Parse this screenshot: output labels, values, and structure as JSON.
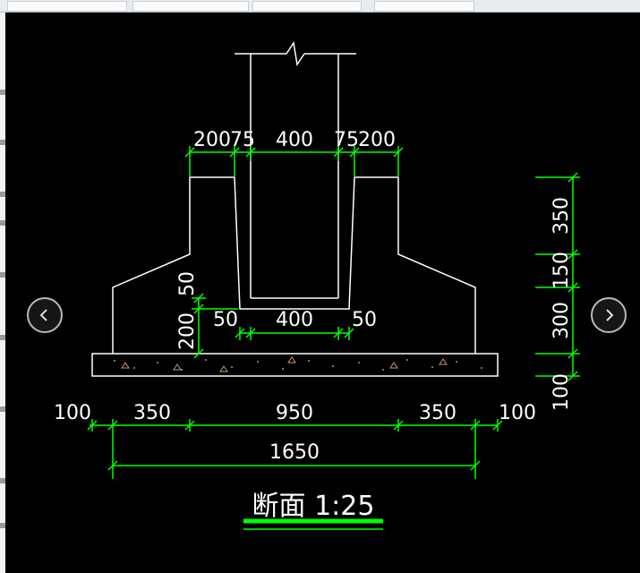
{
  "colors": {
    "background": "#000000",
    "outline": "#ffffff",
    "dimension_line": "#00ff00",
    "title_underline": "#00ff00"
  },
  "dimensions": {
    "top_left_flange": "200",
    "top_left_gap": "75",
    "top_opening": "400",
    "top_right_gap": "75",
    "top_right_flange": "200",
    "right_h1": "350",
    "right_h2": "150",
    "right_h3": "300",
    "right_h4": "100",
    "left_v_small": "50",
    "left_v_large": "200",
    "bottom_left_gap": "50",
    "bottom_opening": "400",
    "bottom_right_gap": "50",
    "base_left_overhang": "100",
    "base_left_slope": "350",
    "base_middle": "950",
    "base_right_slope": "350",
    "base_right_overhang": "100",
    "total_width": "1650"
  },
  "title": "断面 1:25",
  "icons": {
    "prev": "chevron-left-icon",
    "next": "chevron-right-icon"
  }
}
